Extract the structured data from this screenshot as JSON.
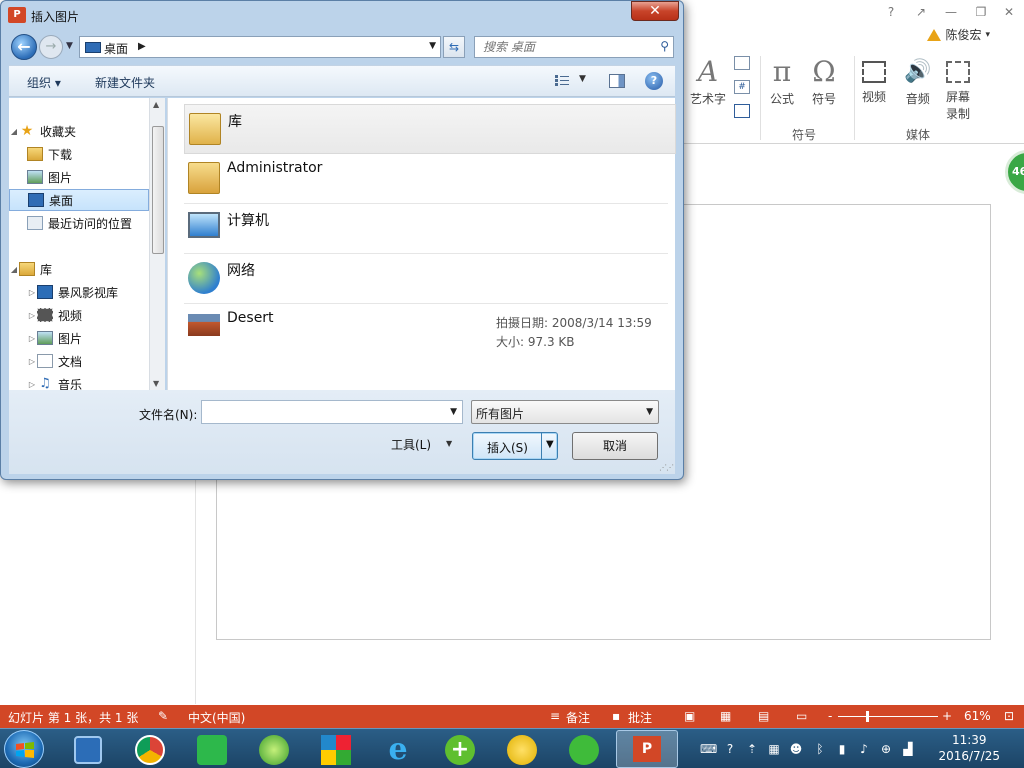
{
  "ppt": {
    "window_controls": [
      "?",
      "↗",
      "—",
      "❐",
      "✕"
    ],
    "user_name": "陈俊宏",
    "ribbon": {
      "art_text": "艺术字",
      "formula": "公式",
      "symbol": "符号",
      "video": "视频",
      "audio": "音频",
      "screen_record_1": "屏幕",
      "screen_record_2": "录制",
      "group_symbols": "符号",
      "group_media": "媒体"
    },
    "badge": "46",
    "statusbar": {
      "slide_info": "幻灯片 第 1 张，共 1 张",
      "language": "中文(中国)",
      "notes": "备注",
      "comments": "批注",
      "zoom_minus": "-",
      "zoom_plus": "+",
      "zoom_percent": "61%"
    }
  },
  "taskbar": {
    "clock_time": "11:39",
    "clock_date": "2016/7/25"
  },
  "dialog": {
    "title": "插入图片",
    "title_icon_text": "P",
    "close_label": "✕",
    "address": {
      "location": "桌面"
    },
    "search": {
      "placeholder": "搜索 桌面"
    },
    "toolbar": {
      "organize": "组织 ▾",
      "new_folder": "新建文件夹"
    },
    "nav": {
      "favorites": "收藏夹",
      "downloads": "下载",
      "pictures": "图片",
      "desktop": "桌面",
      "recent": "最近访问的位置",
      "libraries": "库",
      "storm": "暴风影视库",
      "videos": "视频",
      "pictures2": "图片",
      "documents": "文档",
      "music": "音乐"
    },
    "files": [
      {
        "name": "库"
      },
      {
        "name": "Administrator"
      },
      {
        "name": "计算机"
      },
      {
        "name": "网络"
      },
      {
        "name": "Desert",
        "meta_date": "拍摄日期: 2008/3/14 13:59",
        "meta_size": "大小: 97.3 KB"
      }
    ],
    "filename": {
      "label": "文件名(N):",
      "value": ""
    },
    "filter": "所有图片",
    "tools": "工具(L)",
    "insert": "插入(S)",
    "cancel": "取消"
  }
}
